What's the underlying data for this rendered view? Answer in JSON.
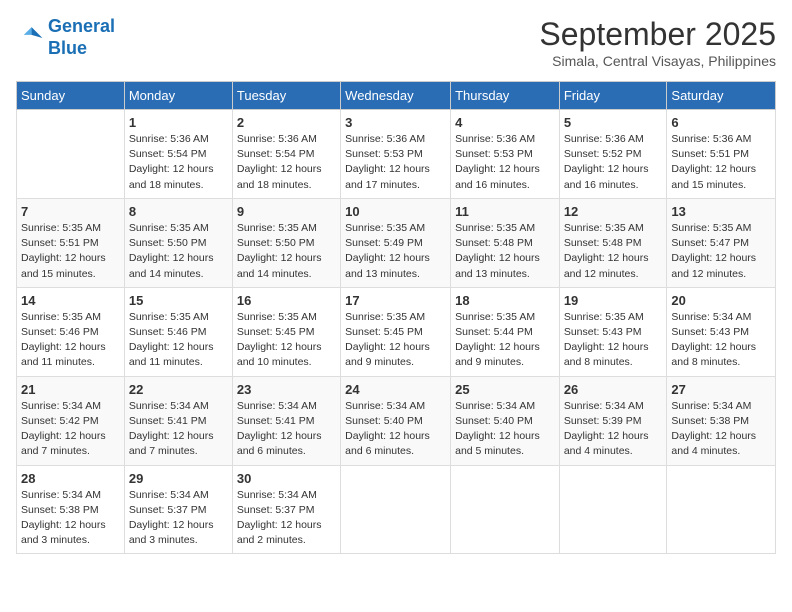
{
  "logo": {
    "line1": "General",
    "line2": "Blue"
  },
  "title": "September 2025",
  "subtitle": "Simala, Central Visayas, Philippines",
  "days_header": [
    "Sunday",
    "Monday",
    "Tuesday",
    "Wednesday",
    "Thursday",
    "Friday",
    "Saturday"
  ],
  "weeks": [
    [
      {
        "num": "",
        "detail": ""
      },
      {
        "num": "1",
        "detail": "Sunrise: 5:36 AM\nSunset: 5:54 PM\nDaylight: 12 hours\nand 18 minutes."
      },
      {
        "num": "2",
        "detail": "Sunrise: 5:36 AM\nSunset: 5:54 PM\nDaylight: 12 hours\nand 18 minutes."
      },
      {
        "num": "3",
        "detail": "Sunrise: 5:36 AM\nSunset: 5:53 PM\nDaylight: 12 hours\nand 17 minutes."
      },
      {
        "num": "4",
        "detail": "Sunrise: 5:36 AM\nSunset: 5:53 PM\nDaylight: 12 hours\nand 16 minutes."
      },
      {
        "num": "5",
        "detail": "Sunrise: 5:36 AM\nSunset: 5:52 PM\nDaylight: 12 hours\nand 16 minutes."
      },
      {
        "num": "6",
        "detail": "Sunrise: 5:36 AM\nSunset: 5:51 PM\nDaylight: 12 hours\nand 15 minutes."
      }
    ],
    [
      {
        "num": "7",
        "detail": "Sunrise: 5:35 AM\nSunset: 5:51 PM\nDaylight: 12 hours\nand 15 minutes."
      },
      {
        "num": "8",
        "detail": "Sunrise: 5:35 AM\nSunset: 5:50 PM\nDaylight: 12 hours\nand 14 minutes."
      },
      {
        "num": "9",
        "detail": "Sunrise: 5:35 AM\nSunset: 5:50 PM\nDaylight: 12 hours\nand 14 minutes."
      },
      {
        "num": "10",
        "detail": "Sunrise: 5:35 AM\nSunset: 5:49 PM\nDaylight: 12 hours\nand 13 minutes."
      },
      {
        "num": "11",
        "detail": "Sunrise: 5:35 AM\nSunset: 5:48 PM\nDaylight: 12 hours\nand 13 minutes."
      },
      {
        "num": "12",
        "detail": "Sunrise: 5:35 AM\nSunset: 5:48 PM\nDaylight: 12 hours\nand 12 minutes."
      },
      {
        "num": "13",
        "detail": "Sunrise: 5:35 AM\nSunset: 5:47 PM\nDaylight: 12 hours\nand 12 minutes."
      }
    ],
    [
      {
        "num": "14",
        "detail": "Sunrise: 5:35 AM\nSunset: 5:46 PM\nDaylight: 12 hours\nand 11 minutes."
      },
      {
        "num": "15",
        "detail": "Sunrise: 5:35 AM\nSunset: 5:46 PM\nDaylight: 12 hours\nand 11 minutes."
      },
      {
        "num": "16",
        "detail": "Sunrise: 5:35 AM\nSunset: 5:45 PM\nDaylight: 12 hours\nand 10 minutes."
      },
      {
        "num": "17",
        "detail": "Sunrise: 5:35 AM\nSunset: 5:45 PM\nDaylight: 12 hours\nand 9 minutes."
      },
      {
        "num": "18",
        "detail": "Sunrise: 5:35 AM\nSunset: 5:44 PM\nDaylight: 12 hours\nand 9 minutes."
      },
      {
        "num": "19",
        "detail": "Sunrise: 5:35 AM\nSunset: 5:43 PM\nDaylight: 12 hours\nand 8 minutes."
      },
      {
        "num": "20",
        "detail": "Sunrise: 5:34 AM\nSunset: 5:43 PM\nDaylight: 12 hours\nand 8 minutes."
      }
    ],
    [
      {
        "num": "21",
        "detail": "Sunrise: 5:34 AM\nSunset: 5:42 PM\nDaylight: 12 hours\nand 7 minutes."
      },
      {
        "num": "22",
        "detail": "Sunrise: 5:34 AM\nSunset: 5:41 PM\nDaylight: 12 hours\nand 7 minutes."
      },
      {
        "num": "23",
        "detail": "Sunrise: 5:34 AM\nSunset: 5:41 PM\nDaylight: 12 hours\nand 6 minutes."
      },
      {
        "num": "24",
        "detail": "Sunrise: 5:34 AM\nSunset: 5:40 PM\nDaylight: 12 hours\nand 6 minutes."
      },
      {
        "num": "25",
        "detail": "Sunrise: 5:34 AM\nSunset: 5:40 PM\nDaylight: 12 hours\nand 5 minutes."
      },
      {
        "num": "26",
        "detail": "Sunrise: 5:34 AM\nSunset: 5:39 PM\nDaylight: 12 hours\nand 4 minutes."
      },
      {
        "num": "27",
        "detail": "Sunrise: 5:34 AM\nSunset: 5:38 PM\nDaylight: 12 hours\nand 4 minutes."
      }
    ],
    [
      {
        "num": "28",
        "detail": "Sunrise: 5:34 AM\nSunset: 5:38 PM\nDaylight: 12 hours\nand 3 minutes."
      },
      {
        "num": "29",
        "detail": "Sunrise: 5:34 AM\nSunset: 5:37 PM\nDaylight: 12 hours\nand 3 minutes."
      },
      {
        "num": "30",
        "detail": "Sunrise: 5:34 AM\nSunset: 5:37 PM\nDaylight: 12 hours\nand 2 minutes."
      },
      {
        "num": "",
        "detail": ""
      },
      {
        "num": "",
        "detail": ""
      },
      {
        "num": "",
        "detail": ""
      },
      {
        "num": "",
        "detail": ""
      }
    ]
  ]
}
